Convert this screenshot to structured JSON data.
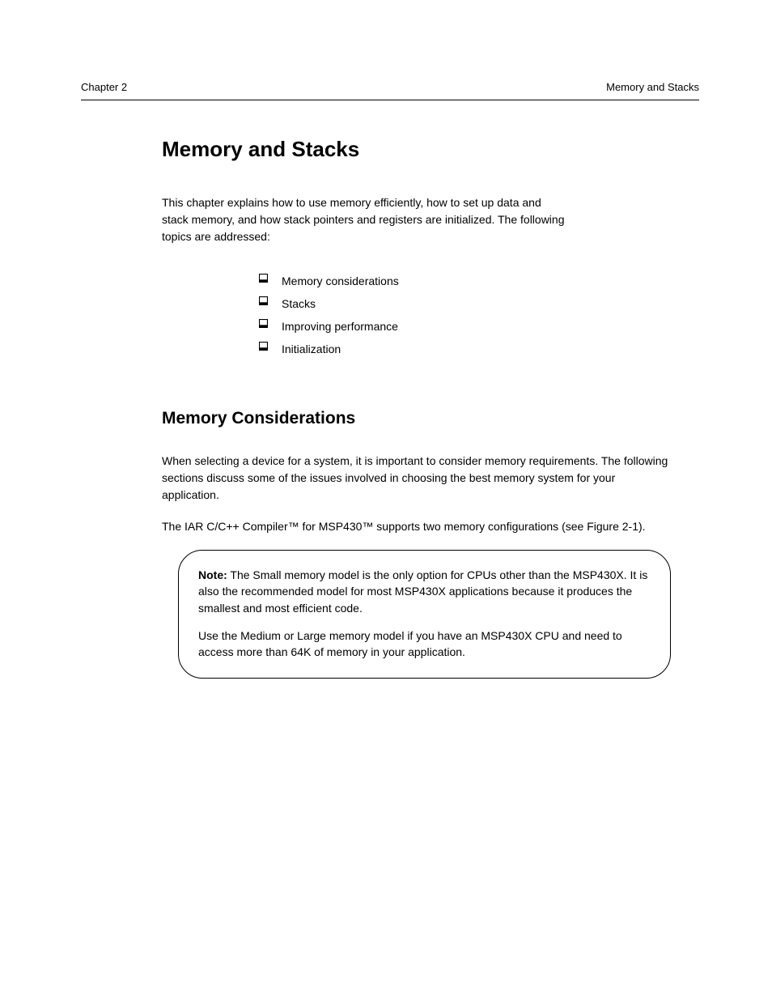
{
  "header": {
    "chapter_label": "Chapter 2",
    "chapter_subject": "Memory and Stacks"
  },
  "title": "Memory and Stacks",
  "intro": {
    "line1": "This chapter explains how to use memory efficiently, how to set up data and",
    "line2": "stack memory, and how stack pointers and registers are initialized. The following",
    "line3": "topics are addressed:"
  },
  "topics": [
    "Memory considerations",
    "Stacks",
    "Improving performance",
    "Initialization"
  ],
  "section": {
    "heading": "Memory Considerations",
    "para1": "When selecting a device for a system, it is important to consider memory requirements. The following sections discuss some of the issues involved in choosing the best memory system for your application.",
    "para2": "The IAR C/C++ Compiler™ for MSP430™ supports two memory configurations (see Figure 2-1)."
  },
  "note": {
    "p1_strong": "Note:",
    "p1_text": " The Small memory model is the only option for CPUs other than the MSP430X. It is also the recommended model for most MSP430X applications because it produces the smallest and most efficient code.",
    "p2": "Use the Medium or Large memory model if you have an MSP430X CPU and need to access more than 64K of memory in your application."
  }
}
